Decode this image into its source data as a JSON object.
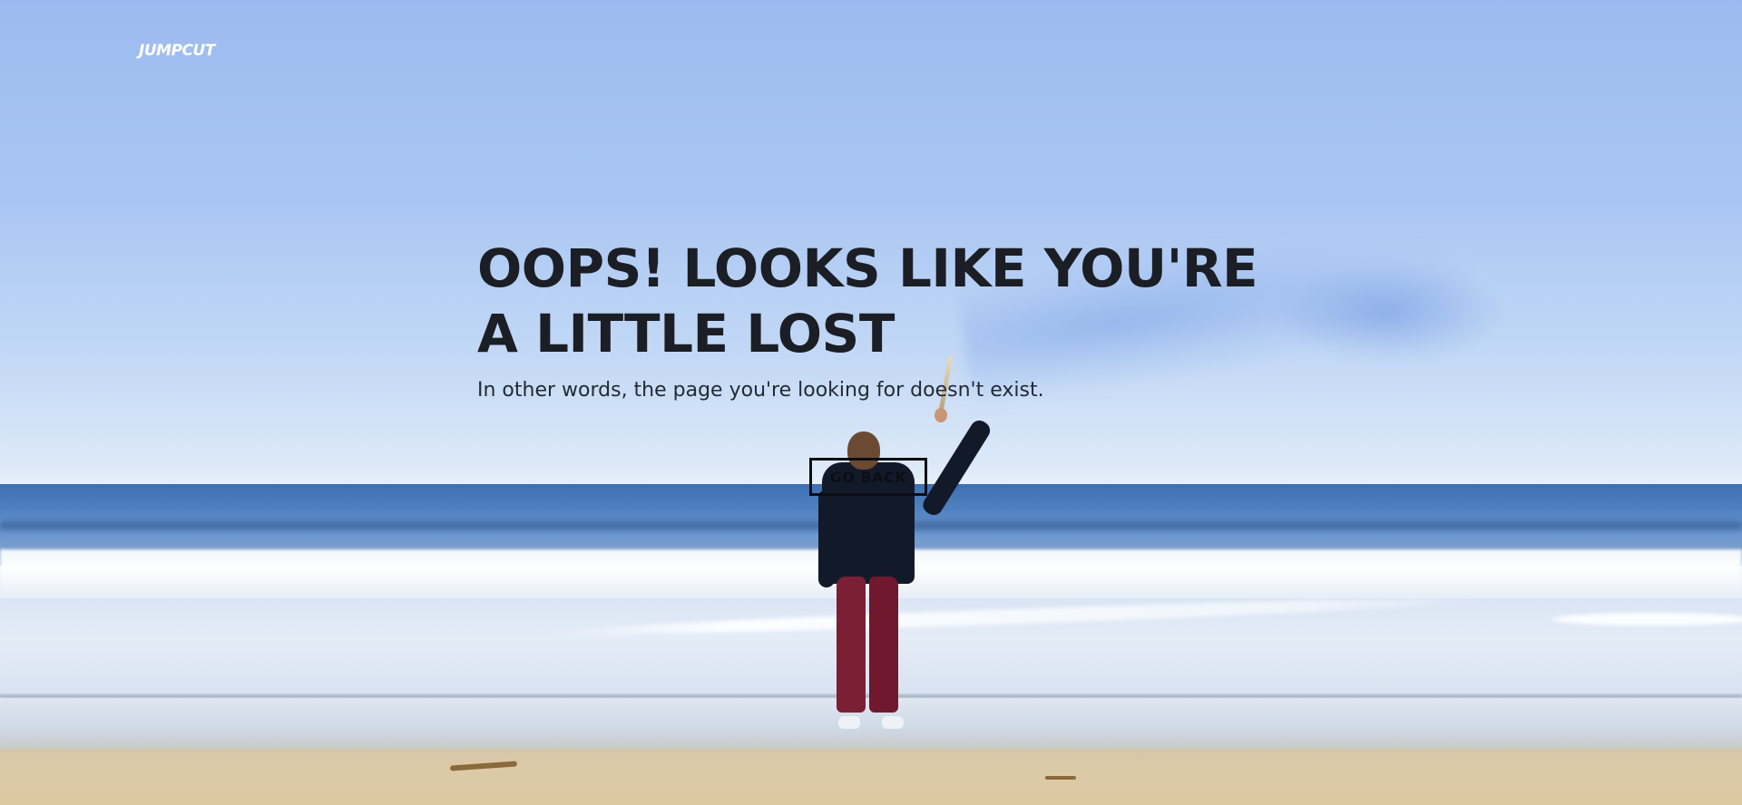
{
  "brand": {
    "logo_text": "JUMPCUT"
  },
  "hero": {
    "headline": "OOPS! LOOKS LIKE YOU'RE A LITTLE LOST",
    "subtitle": "In other words, the page you're looking for doesn't exist.",
    "button_label": "GO BACK"
  },
  "colors": {
    "headline": "#1b1e24",
    "button_border": "#0b0e14",
    "logo": "#ffffff",
    "sky": "#a9c6f3",
    "ocean": "#4f80c0",
    "sand": "#dcc8a2"
  },
  "background": {
    "scene": "beach-photo"
  }
}
